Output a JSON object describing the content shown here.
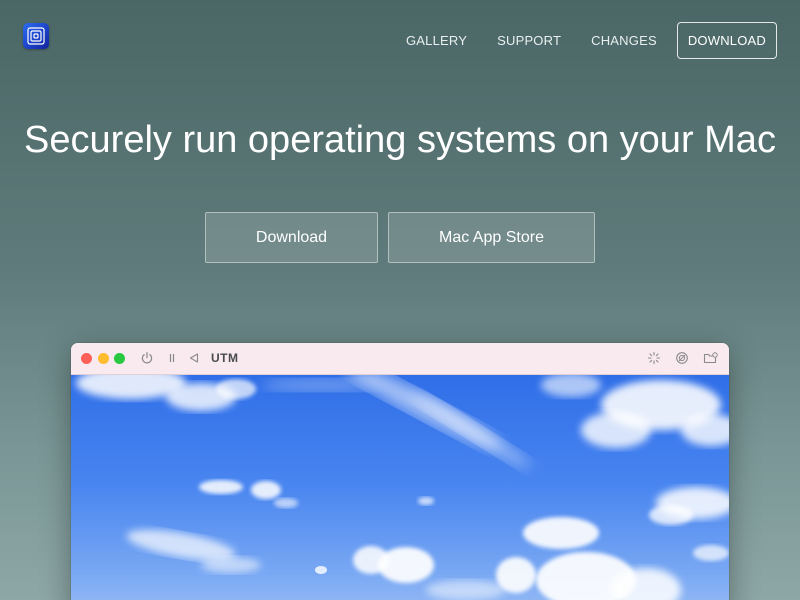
{
  "brand": {
    "logo_icon": "utm-logo-icon"
  },
  "nav": {
    "items": [
      {
        "label": "GALLERY"
      },
      {
        "label": "SUPPORT"
      },
      {
        "label": "CHANGES"
      }
    ],
    "download_label": "DOWNLOAD"
  },
  "hero": {
    "headline": "Securely run operating systems on your Mac",
    "download_button": "Download",
    "store_button": "Mac App Store"
  },
  "window": {
    "title": "UTM",
    "toolbar_icons": [
      "power-icon",
      "pause-icon",
      "back-icon",
      "cursor-capture-icon",
      "disk-icon",
      "folder-share-icon"
    ],
    "screen": "sky-wallpaper"
  },
  "colors": {
    "background_top": "#4a6766",
    "background_bottom": "#8da7a6",
    "traffic_red": "#fe5f57",
    "traffic_yellow": "#febc2e",
    "traffic_green": "#28c840",
    "sky": "#2f6ee8"
  }
}
